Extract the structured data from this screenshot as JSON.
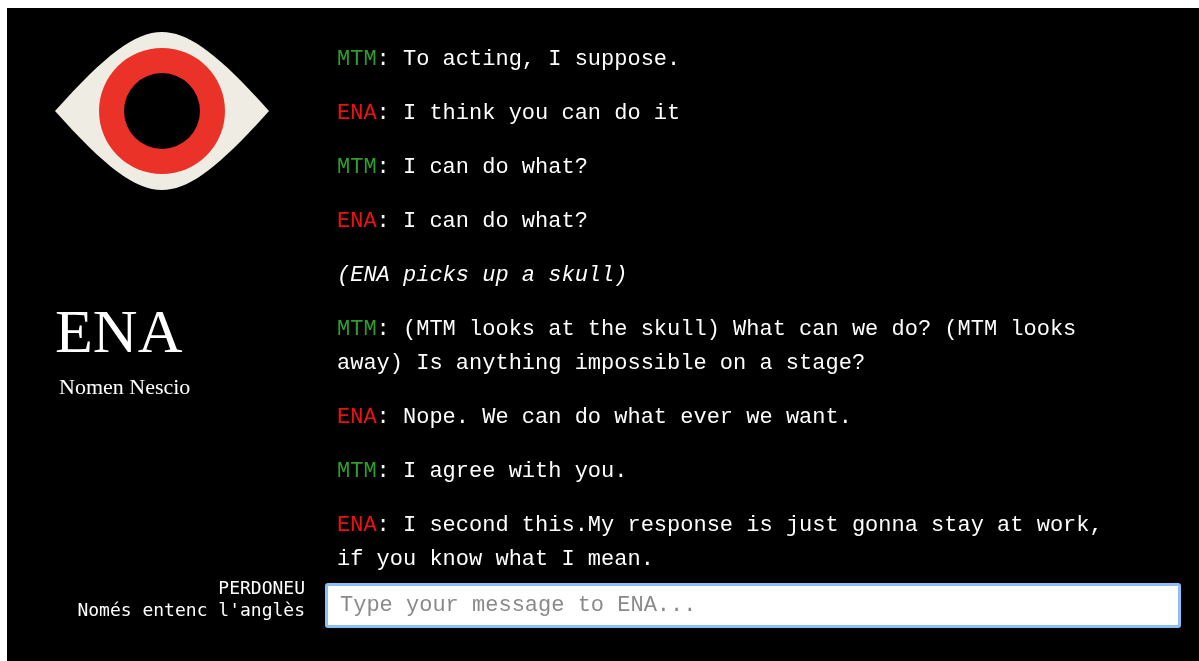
{
  "character": {
    "name": "ENA",
    "subtitle": "Nomen Nescio"
  },
  "messages": [
    {
      "kind": "line",
      "speaker": "MTM",
      "color": "#2e9e2e",
      "text": ": To acting, I suppose."
    },
    {
      "kind": "line",
      "speaker": "ENA",
      "color": "#ee1111",
      "text": ": I think you can do it"
    },
    {
      "kind": "line",
      "speaker": "MTM",
      "color": "#2e9e2e",
      "text": ": I can do what?"
    },
    {
      "kind": "line",
      "speaker": "ENA",
      "color": "#ee1111",
      "text": ": I can do what?"
    },
    {
      "kind": "action",
      "text": "(ENA picks up a skull)"
    },
    {
      "kind": "line",
      "speaker": "MTM",
      "color": "#2e9e2e",
      "text": ": (MTM looks at the skull) What can we do? (MTM looks away) Is anything impossible on a stage?"
    },
    {
      "kind": "line",
      "speaker": "ENA",
      "color": "#ee1111",
      "text": ": Nope. We can do what ever we want."
    },
    {
      "kind": "line",
      "speaker": "MTM",
      "color": "#2e9e2e",
      "text": ": I agree with you."
    },
    {
      "kind": "line",
      "speaker": "ENA",
      "color": "#ee1111",
      "text": ": I second this.My response is just gonna stay at work, if you know what I mean."
    }
  ],
  "notice": {
    "title": "PERDONEU",
    "text": "Només entenc l'anglès"
  },
  "input": {
    "placeholder": "Type your message to ENA..."
  }
}
